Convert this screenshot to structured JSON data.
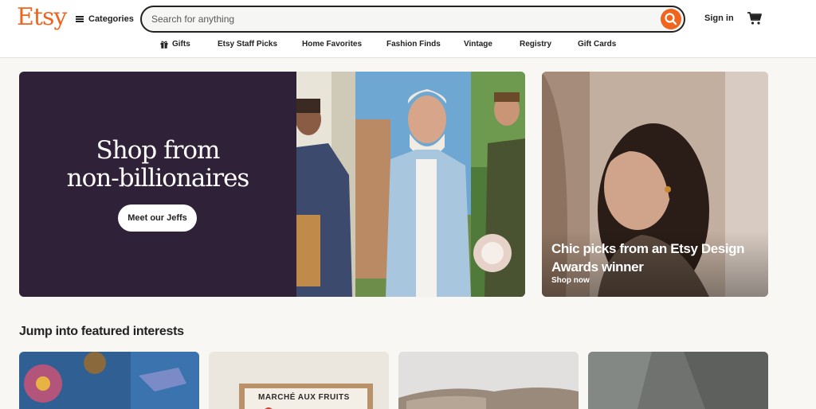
{
  "header": {
    "logo": "Etsy",
    "categories_label": "Categories",
    "search_placeholder": "Search for anything",
    "search_value": "",
    "signin_label": "Sign in"
  },
  "subnav": {
    "items": [
      {
        "label": "Gifts",
        "icon": "gift-icon"
      },
      {
        "label": "Etsy Staff Picks"
      },
      {
        "label": "Home Favorites"
      },
      {
        "label": "Fashion Finds"
      },
      {
        "label": "Vintage"
      },
      {
        "label": "Registry"
      },
      {
        "label": "Gift Cards"
      }
    ]
  },
  "hero": {
    "title_line1": "Shop from",
    "title_line2": "non-billionaires",
    "cta_label": "Meet our Jeffs"
  },
  "side_promo": {
    "title": "Chic picks from an Etsy Design Awards winner",
    "link_label": "Shop now"
  },
  "featured": {
    "title": "Jump into featured interests",
    "cards": [
      {
        "caption": ""
      },
      {
        "caption": "MARCHÉ AUX FRUITS"
      },
      {
        "caption": ""
      },
      {
        "caption": ""
      }
    ]
  },
  "colors": {
    "brand": "#f1641e",
    "hero_bg": "#2f2137",
    "page_bg": "#f8f7f4"
  }
}
